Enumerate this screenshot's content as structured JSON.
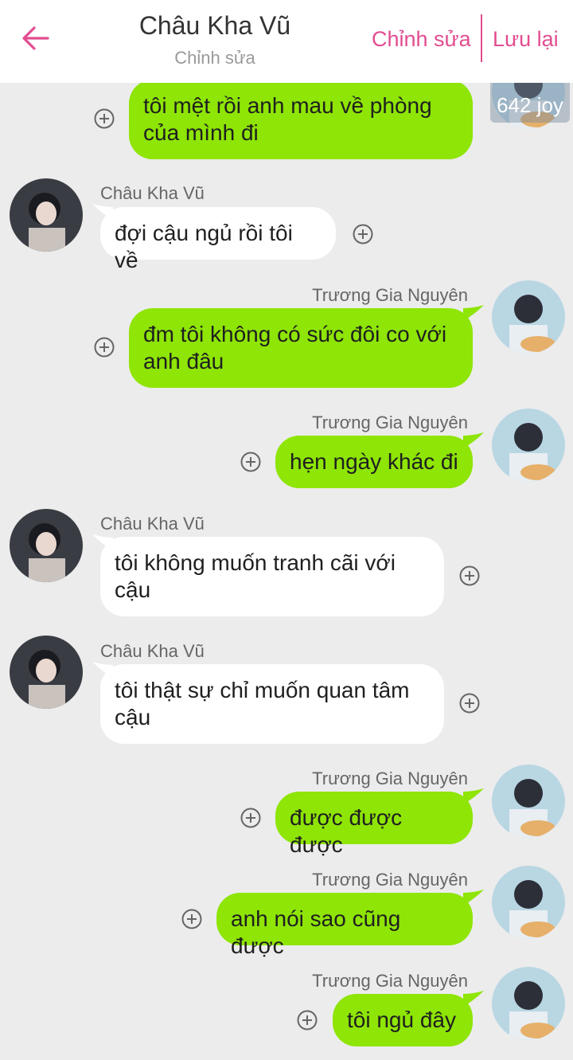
{
  "header": {
    "title": "Châu Kha Vũ",
    "subtitle": "Chỉnh sửa",
    "edit_label": "Chỉnh sửa",
    "save_label": "Lưu lại",
    "accent": "#e24d8f"
  },
  "badge": "642 joy",
  "colors": {
    "green_bubble": "#8ee506",
    "white_bubble": "#ffffff",
    "background": "#ececec"
  },
  "messages": [
    {
      "side": "right",
      "sender": "",
      "text": "tôi mệt rồi anh mau về phòng của mình đi"
    },
    {
      "side": "left",
      "sender": "Châu Kha Vũ",
      "text": "đợi cậu ngủ rồi tôi về"
    },
    {
      "side": "right",
      "sender": "Trương Gia Nguyên",
      "text": "đm tôi không có sức đôi co với anh đâu"
    },
    {
      "side": "right",
      "sender": "Trương Gia Nguyên",
      "text": "hẹn ngày khác đi"
    },
    {
      "side": "left",
      "sender": "Châu Kha Vũ",
      "text": "tôi không muốn tranh cãi với cậu"
    },
    {
      "side": "left",
      "sender": "Châu Kha Vũ",
      "text": "tôi thật sự chỉ muốn quan tâm cậu"
    },
    {
      "side": "right",
      "sender": "Trương Gia Nguyên",
      "text": "được được được"
    },
    {
      "side": "right",
      "sender": "Trương Gia Nguyên",
      "text": "anh nói sao cũng được"
    },
    {
      "side": "right",
      "sender": "Trương Gia Nguyên",
      "text": "tôi ngủ đây"
    }
  ]
}
